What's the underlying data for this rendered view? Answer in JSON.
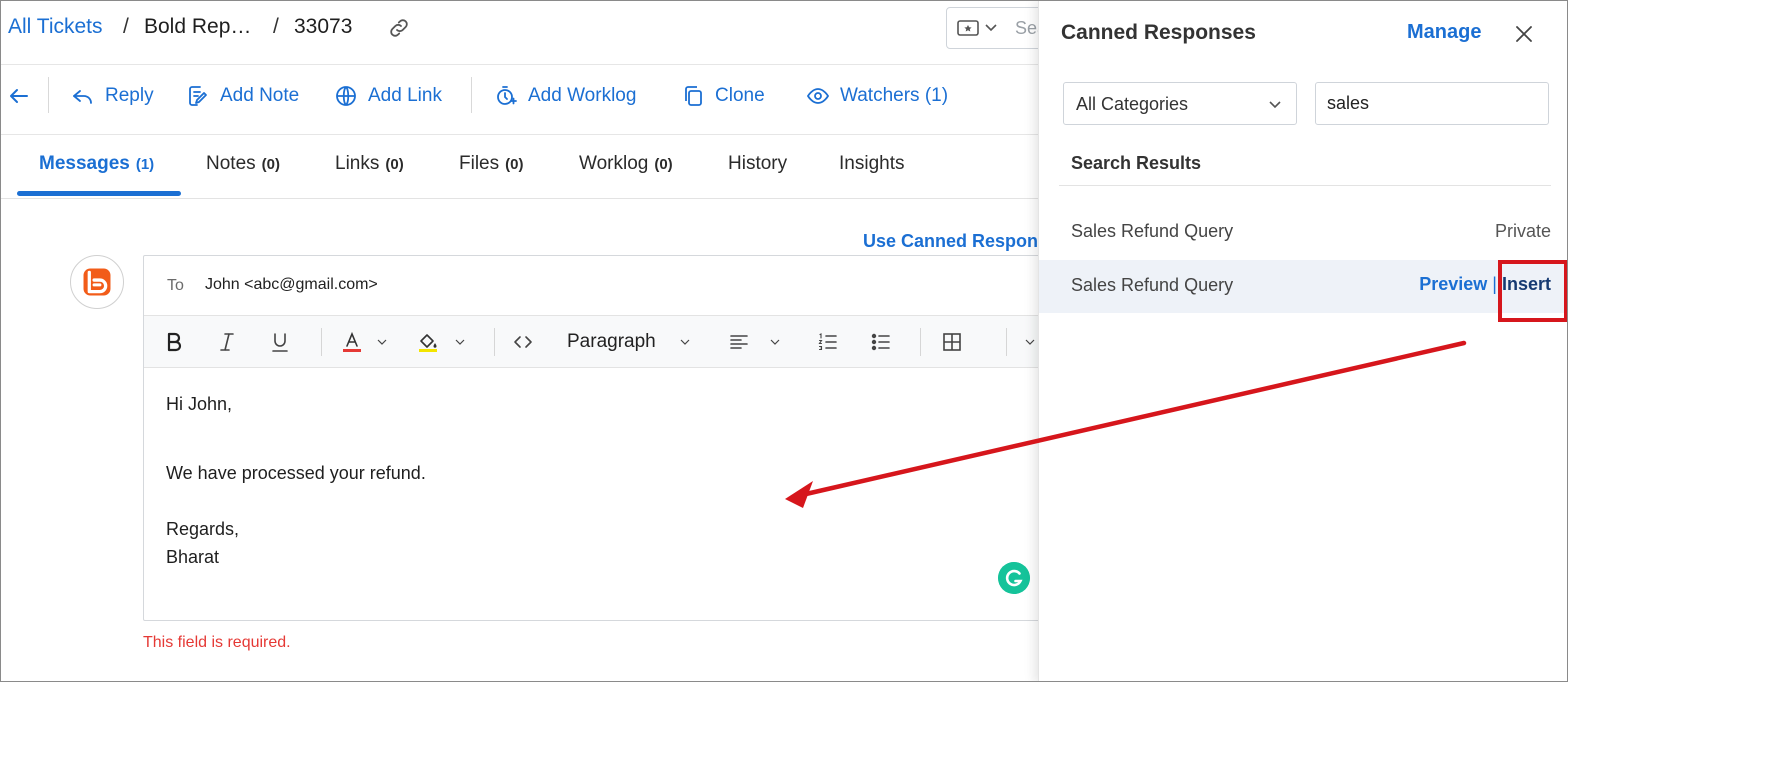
{
  "breadcrumb": {
    "all_tickets": "All Tickets",
    "separator": "/",
    "ticket_name": "Bold Rep…",
    "ticket_id": "33073"
  },
  "header_search": {
    "placeholder": "Sea"
  },
  "toolbar": {
    "reply": "Reply",
    "add_note": "Add Note",
    "add_link": "Add Link",
    "add_worklog": "Add Worklog",
    "clone": "Clone",
    "watchers": "Watchers (1)"
  },
  "tabs": [
    {
      "label": "Messages",
      "count": "(1)"
    },
    {
      "label": "Notes",
      "count": "(0)"
    },
    {
      "label": "Links",
      "count": "(0)"
    },
    {
      "label": "Files",
      "count": "(0)"
    },
    {
      "label": "Worklog",
      "count": "(0)"
    },
    {
      "label": "History",
      "count": ""
    },
    {
      "label": "Insights",
      "count": ""
    }
  ],
  "composer": {
    "use_canned_link": "Use Canned Respon",
    "to_label": "To",
    "to_value": "John <abc@gmail.com>",
    "paragraph_format": "Paragraph",
    "body": {
      "greeting": "Hi John,",
      "message": "We have processed your refund.",
      "closing": "Regards,",
      "signature": "Bharat"
    },
    "error": "This field is required."
  },
  "canned_panel": {
    "title": "Canned Responses",
    "manage": "Manage",
    "category": "All Categories",
    "search_value": "sales",
    "results_heading": "Search Results",
    "results": [
      {
        "name": "Sales Refund Query",
        "badge": "Private"
      },
      {
        "name": "Sales Refund Query",
        "preview": "Preview",
        "divider": "|",
        "insert": "Insert"
      }
    ]
  },
  "colors": {
    "accent": "#1b6fd3",
    "error": "#e53935",
    "annotation": "#d6161c",
    "highlight_row": "#eef2f8",
    "grammarly": "#15c39a"
  },
  "icons": [
    "link-icon",
    "ticket-icon",
    "back-arrow-icon",
    "reply-icon",
    "note-icon",
    "globe-icon",
    "worklog-icon",
    "clone-icon",
    "eye-icon",
    "close-icon",
    "chevron-down-icon",
    "grammarly-icon"
  ]
}
